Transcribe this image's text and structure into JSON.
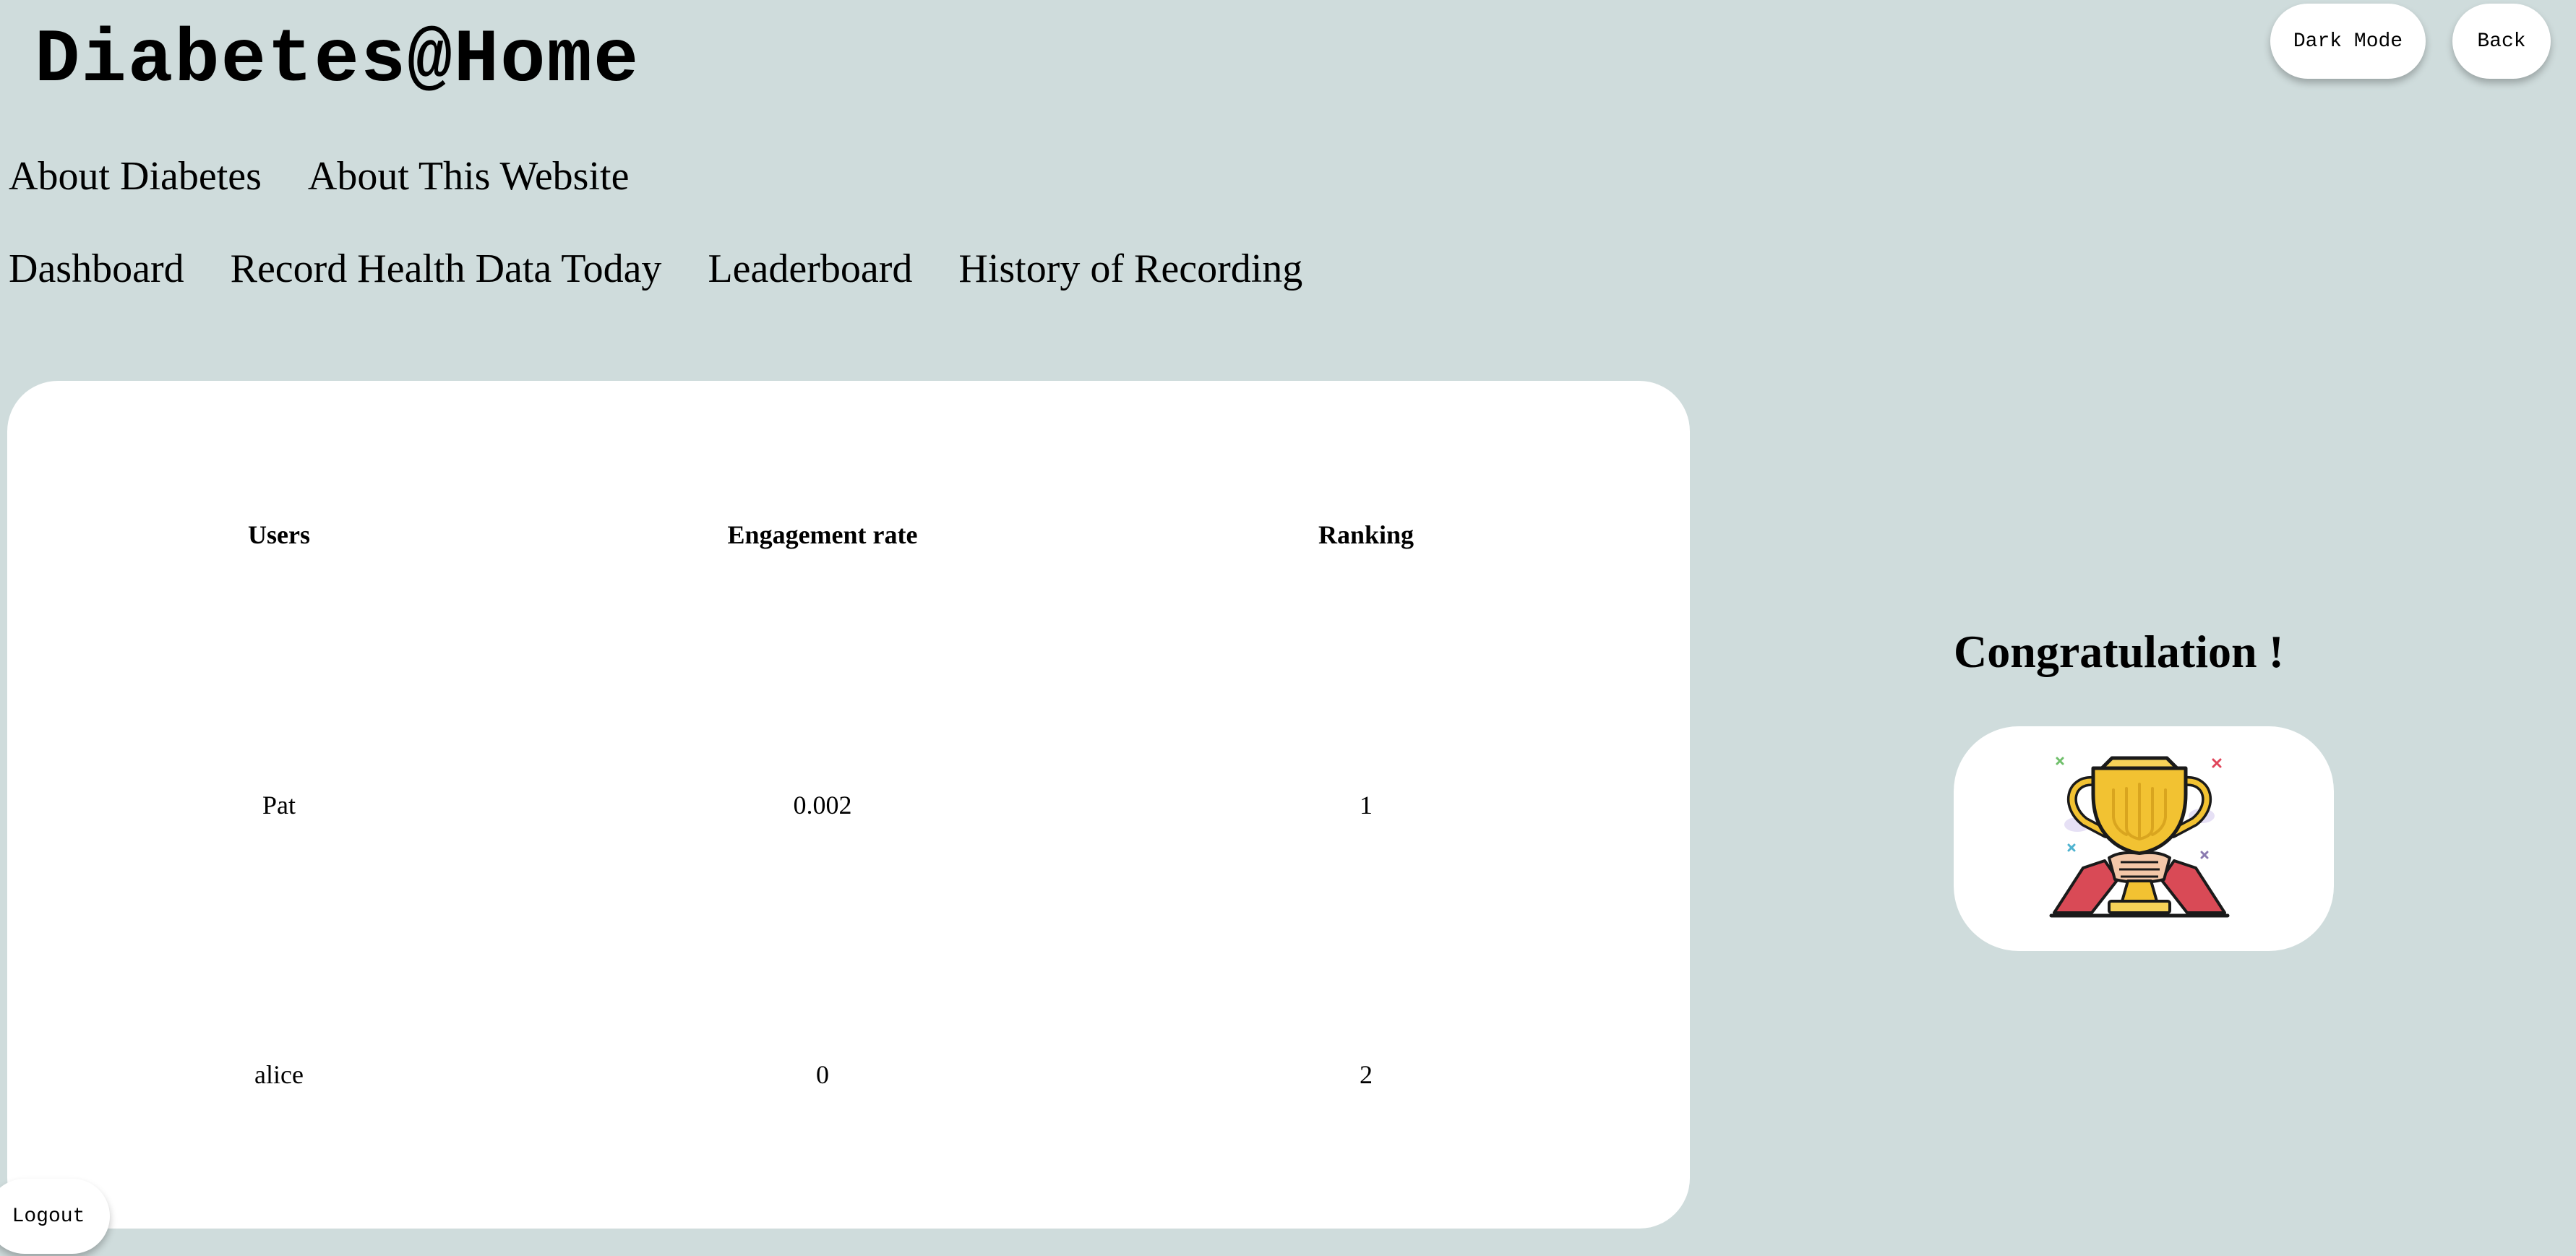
{
  "header": {
    "app_title": "Diabetes@Home",
    "dark_mode_label": "Dark Mode",
    "back_label": "Back"
  },
  "nav": {
    "info_links": [
      "About Diabetes",
      "About This Website"
    ],
    "user_links": [
      "Dashboard",
      "Record Health Data Today",
      "Leaderboard",
      "History of Recording"
    ]
  },
  "leaderboard": {
    "columns": [
      "Users",
      "Engagement rate",
      "Ranking"
    ],
    "rows": [
      {
        "user": "Pat",
        "engagement_rate": "0.002",
        "ranking": "1"
      },
      {
        "user": "alice",
        "engagement_rate": "0",
        "ranking": "2"
      }
    ]
  },
  "congrats": {
    "heading": "Congratulation !",
    "image_icon": "trophy-icon"
  },
  "footer": {
    "logout_label": "Logout"
  },
  "colors": {
    "background": "#cfdcdc",
    "card": "#ffffff",
    "trophy_gold": "#f2c232",
    "trophy_red": "#d94a56"
  }
}
